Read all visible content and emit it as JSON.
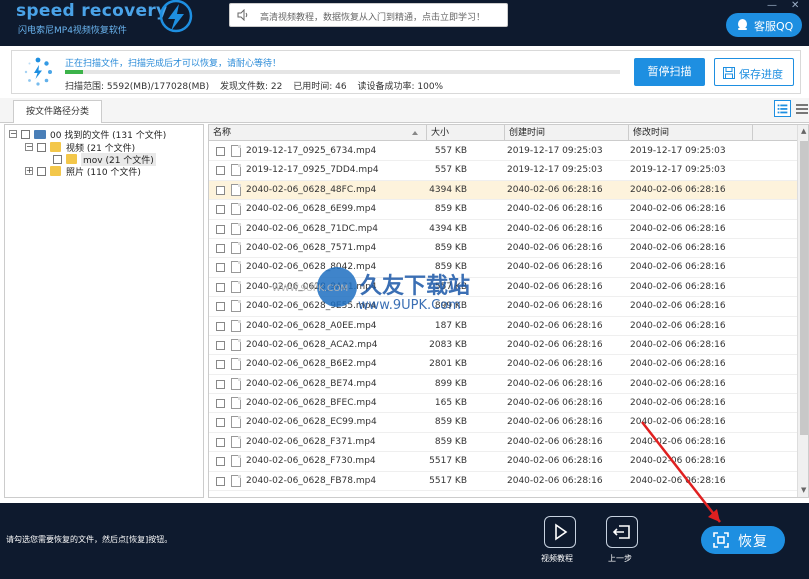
{
  "app": {
    "logo_text": "speed recovery",
    "logo_sub": "闪电索尼MP4视频恢复软件",
    "notice": "高清视频教程，数据恢复从入门到精通，点击立即学习！",
    "kefu_label": "客服QQ",
    "win_min": "—",
    "win_close": "✕"
  },
  "scan": {
    "status": "正在扫描文件，扫描完成后才可以恢复，请耐心等待！",
    "progress": 0.032,
    "range_label": "扫描范围: 5592(MB)/177028(MB)",
    "found_label": "发现文件数: 22",
    "time_label": "已用时间: 46",
    "rate_label": "读设备成功率: 100%",
    "pause_label": "暂停扫描",
    "save_label": "保存进度",
    "accent": "#1e8fe1",
    "progress_color": "#3cb34a"
  },
  "tabs": {
    "by_path": "按文件路径分类"
  },
  "tree": {
    "root": "00 找到的文件  (131 个文件)",
    "video": "视频     (21 个文件)",
    "mov": "mov      (21 个文件)",
    "photo": "照片     (110 个文件)",
    "expand_minus": "−",
    "expand_plus": "+"
  },
  "table": {
    "columns": {
      "name": "名称",
      "size": "大小",
      "ctime": "创建时间",
      "mtime": "修改时间"
    },
    "rows": [
      {
        "name": "2019-12-17_0925_6734.mp4",
        "size": "557 KB",
        "ctime": "2019-12-17  09:25:03",
        "mtime": "2019-12-17  09:25:03"
      },
      {
        "name": "2019-12-17_0925_7DD4.mp4",
        "size": "557 KB",
        "ctime": "2019-12-17  09:25:03",
        "mtime": "2019-12-17  09:25:03"
      },
      {
        "name": "2040-02-06_0628_48FC.mp4",
        "size": "4394 KB",
        "ctime": "2040-02-06  06:28:16",
        "mtime": "2040-02-06  06:28:16"
      },
      {
        "name": "2040-02-06_0628_6E99.mp4",
        "size": "859 KB",
        "ctime": "2040-02-06  06:28:16",
        "mtime": "2040-02-06  06:28:16"
      },
      {
        "name": "2040-02-06_0628_71DC.mp4",
        "size": "4394 KB",
        "ctime": "2040-02-06  06:28:16",
        "mtime": "2040-02-06  06:28:16"
      },
      {
        "name": "2040-02-06_0628_7571.mp4",
        "size": "859 KB",
        "ctime": "2040-02-06  06:28:16",
        "mtime": "2040-02-06  06:28:16"
      },
      {
        "name": "2040-02-06_0628_8042.mp4",
        "size": "859 KB",
        "ctime": "2040-02-06  06:28:16",
        "mtime": "2040-02-06  06:28:16"
      },
      {
        "name": "2040-02-06_0628_9A21.mp4",
        "size": "557 KB",
        "ctime": "2040-02-06  06:28:16",
        "mtime": "2040-02-06  06:28:16"
      },
      {
        "name": "2040-02-06_0628_9E55.mp4",
        "size": "899 KB",
        "ctime": "2040-02-06  06:28:16",
        "mtime": "2040-02-06  06:28:16"
      },
      {
        "name": "2040-02-06_0628_A0EE.mp4",
        "size": "187 KB",
        "ctime": "2040-02-06  06:28:16",
        "mtime": "2040-02-06  06:28:16"
      },
      {
        "name": "2040-02-06_0628_ACA2.mp4",
        "size": "2083 KB",
        "ctime": "2040-02-06  06:28:16",
        "mtime": "2040-02-06  06:28:16"
      },
      {
        "name": "2040-02-06_0628_B6E2.mp4",
        "size": "2801 KB",
        "ctime": "2040-02-06  06:28:16",
        "mtime": "2040-02-06  06:28:16"
      },
      {
        "name": "2040-02-06_0628_BE74.mp4",
        "size": "899 KB",
        "ctime": "2040-02-06  06:28:16",
        "mtime": "2040-02-06  06:28:16"
      },
      {
        "name": "2040-02-06_0628_BFEC.mp4",
        "size": "165 KB",
        "ctime": "2040-02-06  06:28:16",
        "mtime": "2040-02-06  06:28:16"
      },
      {
        "name": "2040-02-06_0628_EC99.mp4",
        "size": "859 KB",
        "ctime": "2040-02-06  06:28:16",
        "mtime": "2040-02-06  06:28:16"
      },
      {
        "name": "2040-02-06_0628_F371.mp4",
        "size": "859 KB",
        "ctime": "2040-02-06  06:28:16",
        "mtime": "2040-02-06  06:28:16"
      },
      {
        "name": "2040-02-06_0628_F730.mp4",
        "size": "5517 KB",
        "ctime": "2040-02-06  06:28:16",
        "mtime": "2040-02-06  06:28:16"
      },
      {
        "name": "2040-02-06_0628_FB78.mp4",
        "size": "5517 KB",
        "ctime": "2040-02-06  06:28:16",
        "mtime": "2040-02-06  06:28:16"
      }
    ],
    "selected_index": 2
  },
  "watermark": {
    "title": "久友下载站",
    "url": "www.9UPK.Com",
    "small": "WWW.9UPK.COM"
  },
  "footer": {
    "tip": "请勾选您需要恢复的文件，然后点[恢复]按钮。",
    "tutorial_label": "视频教程",
    "back_label": "上一步",
    "recover_label": "恢复"
  }
}
